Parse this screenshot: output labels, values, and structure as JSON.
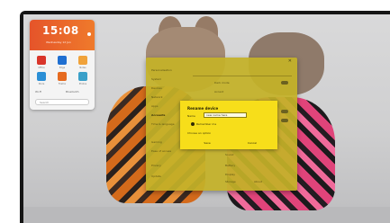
{
  "widget": {
    "time": "15:08",
    "date": "Wednesday 12 Jun",
    "apps": [
      {
        "label": "Office",
        "color": "#d9352a"
      },
      {
        "label": "Edge",
        "color": "#1f6fd1"
      },
      {
        "label": "Notes",
        "color": "#f0a23a"
      },
      {
        "label": "Store",
        "color": "#2b8fd6"
      },
      {
        "label": "Firefox",
        "color": "#e66a1f"
      },
      {
        "label": "Photos",
        "color": "#3aa0c9"
      }
    ],
    "row_left": "Wi-Fi",
    "row_right": "Bluetooth",
    "search_placeholder": "Search"
  },
  "settings": {
    "sidebar": [
      "Personalisation",
      "System",
      "Devices",
      "Network",
      "Apps",
      "Accounts",
      "Time & language",
      "Gaming",
      "Ease of access",
      "Privacy",
      "Update"
    ],
    "right_items": [
      "Dark mode",
      "Accent",
      "Sound",
      "Battery",
      "Display",
      "Storage",
      "About"
    ]
  },
  "dialog": {
    "heading": "Rename device",
    "name_label": "Name",
    "name_value": "new name here",
    "checkbox_label": "Remember me",
    "section_text": "Choose an option",
    "ok_label": "Save",
    "cancel_label": "Cancel"
  }
}
